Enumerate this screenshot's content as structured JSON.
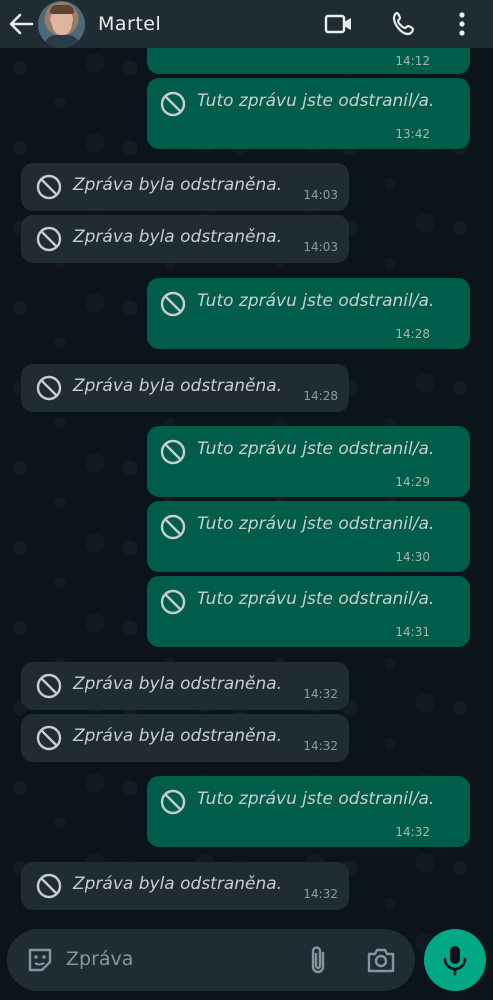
{
  "header": {
    "contact_name": "Martel",
    "back_icon": "arrow-left-icon",
    "video_icon": "video-camera-icon",
    "call_icon": "phone-icon",
    "menu_icon": "more-vertical-icon"
  },
  "messages": [
    {
      "direction": "out",
      "text": "Tuto zprávu jste odstranil/a.",
      "time": "13:42"
    },
    {
      "direction": "in",
      "text": "Zpráva byla odstraněna.",
      "time": "14:03"
    },
    {
      "direction": "in",
      "text": "Zpráva byla odstraněna.",
      "time": "14:03"
    },
    {
      "direction": "out",
      "text": "Tuto zprávu jste odstranil/a.",
      "time": "14:28"
    },
    {
      "direction": "in",
      "text": "Zpráva byla odstraněna.",
      "time": "14:28"
    },
    {
      "direction": "out",
      "text": "Tuto zprávu jste odstranil/a.",
      "time": "14:29"
    },
    {
      "direction": "out",
      "text": "Tuto zprávu jste odstranil/a.",
      "time": "14:30"
    },
    {
      "direction": "out",
      "text": "Tuto zprávu jste odstranil/a.",
      "time": "14:31"
    },
    {
      "direction": "in",
      "text": "Zpráva byla odstraněna.",
      "time": "14:32"
    },
    {
      "direction": "in",
      "text": "Zpráva byla odstraněna.",
      "time": "14:32"
    },
    {
      "direction": "out",
      "text": "Tuto zprávu jste odstranil/a.",
      "time": "14:32"
    },
    {
      "direction": "in",
      "text": "Zpráva byla odstraněna.",
      "time": "14:32"
    }
  ],
  "composer": {
    "placeholder": "Zpráva",
    "emoji_icon": "sticker-icon",
    "attach_icon": "paperclip-icon",
    "camera_icon": "camera-icon",
    "mic_icon": "microphone-icon"
  },
  "colors": {
    "background": "#0b141a",
    "header": "#1f2c34",
    "outgoing_bubble": "#005c4b",
    "incoming_bubble": "#202c33",
    "accent": "#00a884"
  }
}
